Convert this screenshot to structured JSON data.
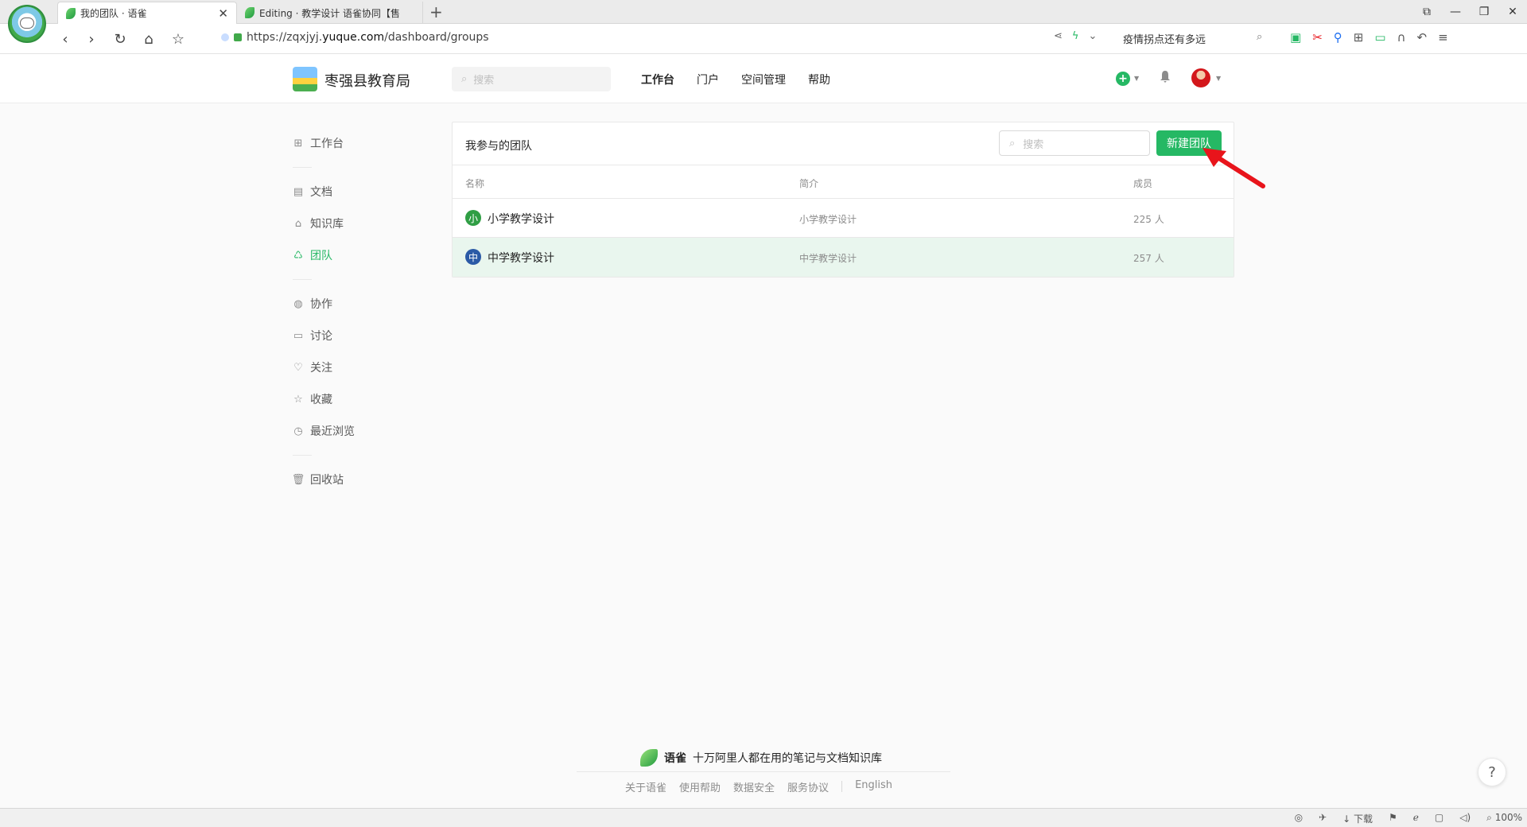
{
  "browser": {
    "tabs": [
      {
        "title": "我的团队 · 语雀",
        "active": true
      },
      {
        "title": "Editing · 教学设计 语雀协同【售",
        "active": false
      }
    ],
    "close_glyph": "✕",
    "new_tab_glyph": "+",
    "url_prefix": "https://zqxjyj.",
    "url_domain": "yuque.com",
    "url_path": "/dashboard/groups",
    "hot_search": "疫情拐点还有多远",
    "window_controls": [
      "⧉",
      "—",
      "❐",
      "✕"
    ],
    "status": {
      "download_label": "下载",
      "zoom": "100%"
    }
  },
  "header": {
    "org_name": "枣强县教育局",
    "search_placeholder": "搜索",
    "nav": [
      {
        "label": "工作台",
        "active": true
      },
      {
        "label": "门户",
        "active": false
      },
      {
        "label": "空间管理",
        "active": false
      },
      {
        "label": "帮助",
        "active": false
      }
    ],
    "plus_glyph": "+"
  },
  "sidebar": {
    "groups": [
      [
        {
          "label": "工作台",
          "icon": "dashboard-icon"
        }
      ],
      [
        {
          "label": "文档",
          "icon": "document-icon"
        },
        {
          "label": "知识库",
          "icon": "knowledge-base-icon"
        },
        {
          "label": "团队",
          "icon": "team-icon",
          "active": true
        }
      ],
      [
        {
          "label": "协作",
          "icon": "collaboration-icon"
        },
        {
          "label": "讨论",
          "icon": "discussion-icon"
        },
        {
          "label": "关注",
          "icon": "heart-icon"
        },
        {
          "label": "收藏",
          "icon": "star-icon"
        },
        {
          "label": "最近浏览",
          "icon": "clock-icon"
        }
      ],
      [
        {
          "label": "回收站",
          "icon": "trash-icon"
        }
      ]
    ]
  },
  "panel": {
    "title": "我参与的团队",
    "search_placeholder": "搜索",
    "new_team_button": "新建团队",
    "columns": {
      "name": "名称",
      "description": "简介",
      "members": "成员"
    },
    "rows": [
      {
        "badge": "小",
        "badge_color": "#2f9e44",
        "name": "小学教学设计",
        "description": "小学教学设计",
        "members": "225 人"
      },
      {
        "badge": "中",
        "badge_color": "#2b5aa6",
        "name": "中学教学设计",
        "description": "中学教学设计",
        "members": "257 人"
      }
    ]
  },
  "footer": {
    "brand": "语雀",
    "tagline": "十万阿里人都在用的笔记与文档知识库",
    "links": [
      "关于语雀",
      "使用帮助",
      "数据安全",
      "服务协议"
    ],
    "lang": "English",
    "help_glyph": "?"
  },
  "colors": {
    "accent": "#25b864",
    "annotation_arrow": "#e8141b"
  }
}
